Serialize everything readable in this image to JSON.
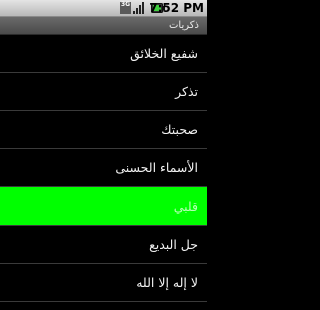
{
  "status_bar": {
    "network": "3G",
    "time": "7:52 PM"
  },
  "title_bar": {
    "title": "ذكريات"
  },
  "menu": {
    "items": [
      {
        "label": "شفيع الخلائق"
      },
      {
        "label": "تذكر"
      },
      {
        "label": "صحبتك"
      },
      {
        "label": "الأسماء الحسنى"
      },
      {
        "label": "قلبي"
      },
      {
        "label": "جل البديع"
      },
      {
        "label": "لا إله إلا الله"
      }
    ],
    "selected_index": 4
  },
  "colors": {
    "background": "#000000",
    "selected_highlight": "#00ff00",
    "text": "#f2f2f2"
  }
}
